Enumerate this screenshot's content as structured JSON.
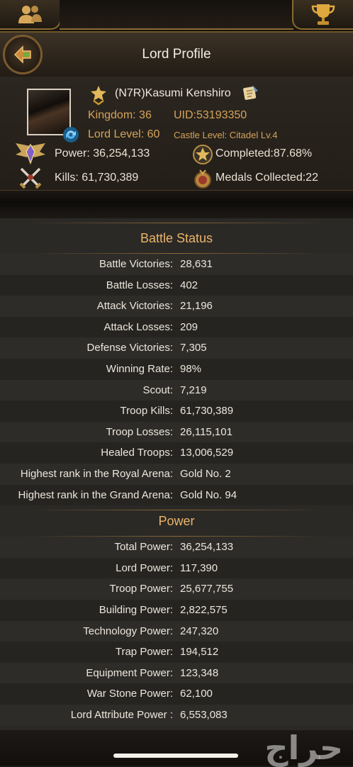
{
  "header": {
    "title": "Lord Profile",
    "left_tab_icon": "friends-icon",
    "right_tab_icon": "trophy-icon",
    "back_icon": "back-arrow-icon"
  },
  "profile": {
    "name": "(N7R)Kasumi Kenshiro",
    "kingdom": "Kingdom: 36",
    "uid": "UID:53193350",
    "lord_level": "Lord Level: 60",
    "castle_level": "Castle Level: Citadel Lv.4",
    "power": "Power: 36,254,133",
    "completed": "Completed:87.68%",
    "kills": "Kills: 61,730,389",
    "medals": "Medals Collected:22"
  },
  "battle_status": {
    "heading": "Battle Status",
    "rows": [
      {
        "label": "Battle Victories:",
        "value": "28,631"
      },
      {
        "label": "Battle Losses:",
        "value": "402"
      },
      {
        "label": "Attack Victories:",
        "value": "21,196"
      },
      {
        "label": "Attack Losses:",
        "value": "209"
      },
      {
        "label": "Defense Victories:",
        "value": "7,305"
      },
      {
        "label": "Winning Rate:",
        "value": "98%"
      },
      {
        "label": "Scout:",
        "value": "7,219"
      },
      {
        "label": "Troop Kills:",
        "value": "61,730,389"
      },
      {
        "label": "Troop Losses:",
        "value": "26,115,101"
      },
      {
        "label": "Healed Troops:",
        "value": "13,006,529"
      },
      {
        "label": "Highest rank in the Royal Arena:",
        "value": "Gold No. 2"
      },
      {
        "label": "Highest rank in the Grand Arena:",
        "value": "Gold No. 94"
      }
    ]
  },
  "power": {
    "heading": "Power",
    "rows": [
      {
        "label": "Total Power:",
        "value": "36,254,133"
      },
      {
        "label": "Lord Power:",
        "value": "117,390"
      },
      {
        "label": "Troop Power:",
        "value": "25,677,755"
      },
      {
        "label": "Building Power:",
        "value": "2,822,575"
      },
      {
        "label": "Technology Power:",
        "value": "247,320"
      },
      {
        "label": "Trap Power:",
        "value": "194,512"
      },
      {
        "label": "Equipment Power:",
        "value": "123,348"
      },
      {
        "label": "War Stone Power:",
        "value": "62,100"
      },
      {
        "label": "Lord Attribute Power :",
        "value": "6,553,083"
      }
    ]
  },
  "watermark": "حراج",
  "colors": {
    "gold_text": "#d4a45a",
    "heading_text": "#eab468",
    "border_gold": "#8a6a32"
  }
}
